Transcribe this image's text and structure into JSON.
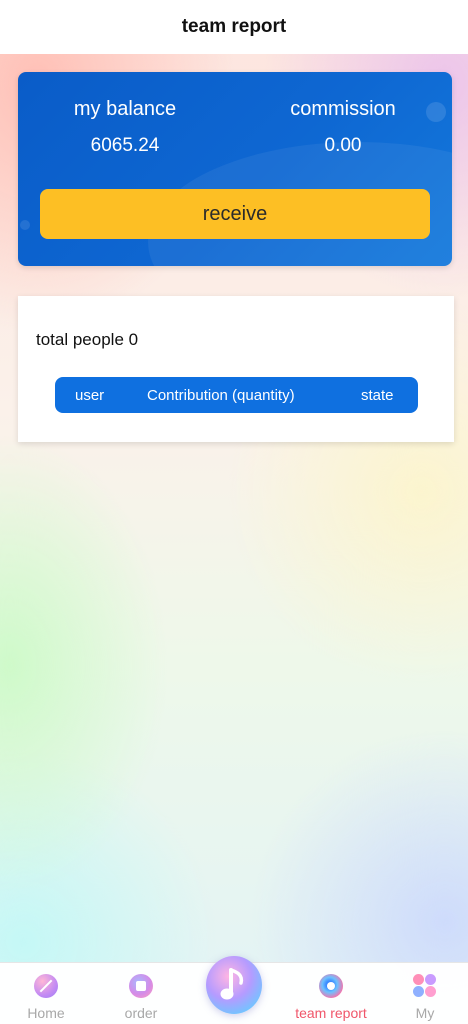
{
  "header": {
    "title": "team report"
  },
  "balance_card": {
    "balance_label": "my balance",
    "balance_value": "6065.24",
    "commission_label": "commission",
    "commission_value": "0.00",
    "receive_button": "receive"
  },
  "team": {
    "total_people_text": "total people 0",
    "columns": [
      "user",
      "Contribution (quantity)",
      "state"
    ]
  },
  "nav": {
    "items": [
      {
        "label": "Home",
        "icon": "home-icon",
        "active": false
      },
      {
        "label": "order",
        "icon": "order-icon",
        "active": false
      },
      {
        "label": "team report",
        "icon": "team-report-icon",
        "active": true
      },
      {
        "label": "My",
        "icon": "my-icon",
        "active": false
      }
    ],
    "center_icon": "music-note-icon"
  },
  "colors": {
    "card_blue": "#0e67d2",
    "button_yellow": "#fdbf24",
    "table_header_blue": "#0f70e0",
    "nav_active": "#f0566a",
    "nav_inactive": "#a8a8a8"
  }
}
